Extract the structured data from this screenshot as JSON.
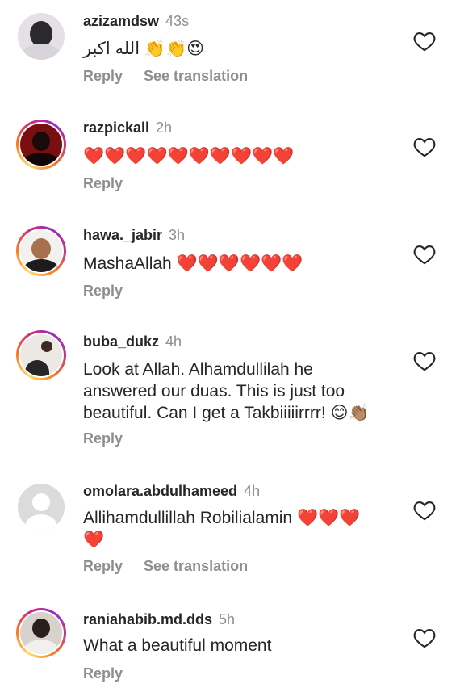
{
  "icons": {
    "like": "heart-outline-icon"
  },
  "comments": [
    {
      "user": "azizamdsw",
      "time": "43s",
      "text": "الله اكبر 👏👏😍",
      "actions": [
        "Reply",
        "See translation"
      ]
    },
    {
      "user": "razpickall",
      "time": "2h",
      "text": "❤️❤️❤️❤️❤️❤️❤️❤️❤️❤️",
      "actions": [
        "Reply"
      ]
    },
    {
      "user": "hawa._jabir",
      "time": "3h",
      "text": "MashaAllah ❤️❤️❤️❤️❤️❤️",
      "actions": [
        "Reply"
      ]
    },
    {
      "user": "buba_dukz",
      "time": "4h",
      "text": "Look at Allah. Alhamdullilah he answered our duas. This is just too beautiful. Can I get a Takbiiiiirrrr! 😊👏🏽",
      "actions": [
        "Reply"
      ]
    },
    {
      "user": "omolara.abdulhameed",
      "time": "4h",
      "text": "Allihamdullillah Robilialamin ❤️❤️❤️ ❤️",
      "actions": [
        "Reply",
        "See translation"
      ]
    },
    {
      "user": "raniahabib.md.dds",
      "time": "5h",
      "text": "What a beautiful moment",
      "actions": [
        "Reply"
      ]
    }
  ]
}
